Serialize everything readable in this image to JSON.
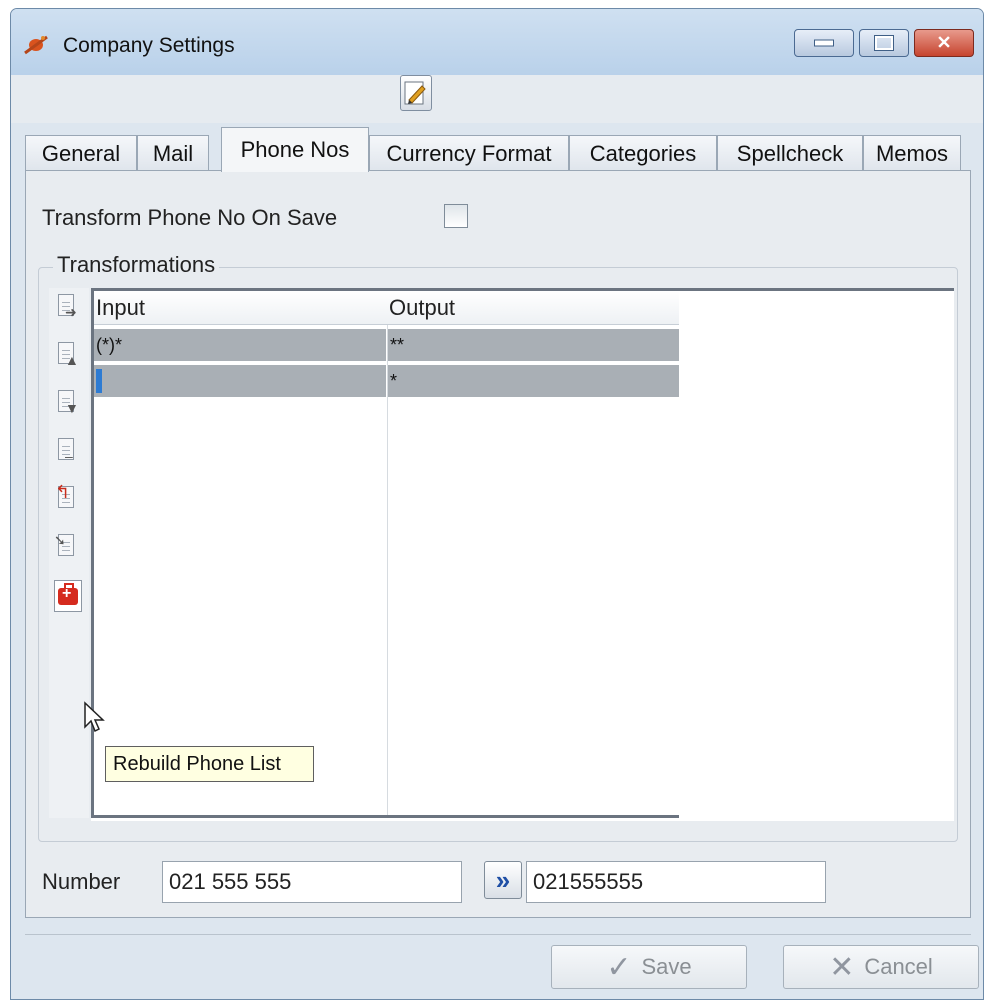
{
  "window": {
    "title": "Company Settings"
  },
  "tabs": [
    {
      "label": "General"
    },
    {
      "label": "Mail"
    },
    {
      "label": "Phone Nos"
    },
    {
      "label": "Currency Format"
    },
    {
      "label": "Categories"
    },
    {
      "label": "Spellcheck"
    },
    {
      "label": "Memos"
    }
  ],
  "active_tab": "Phone Nos",
  "phone": {
    "transform_label": "Transform Phone No On Save",
    "transform_checked": false,
    "group_title": "Transformations",
    "columns": {
      "input": "Input",
      "output": "Output"
    },
    "rows": [
      {
        "input": "(*)*",
        "output": "**"
      },
      {
        "input": "",
        "output": "*"
      }
    ],
    "tooltip": "Rebuild Phone List",
    "number_label": "Number",
    "number_value": "021 555 555",
    "result_value": "021555555"
  },
  "buttons": {
    "save": "Save",
    "cancel": "Cancel"
  },
  "icons": {
    "app": "satellite-icon",
    "edit": "edit-icon",
    "convert": "double-chevron-right-icon",
    "save": "checkmark-icon",
    "cancel": "x-icon"
  }
}
